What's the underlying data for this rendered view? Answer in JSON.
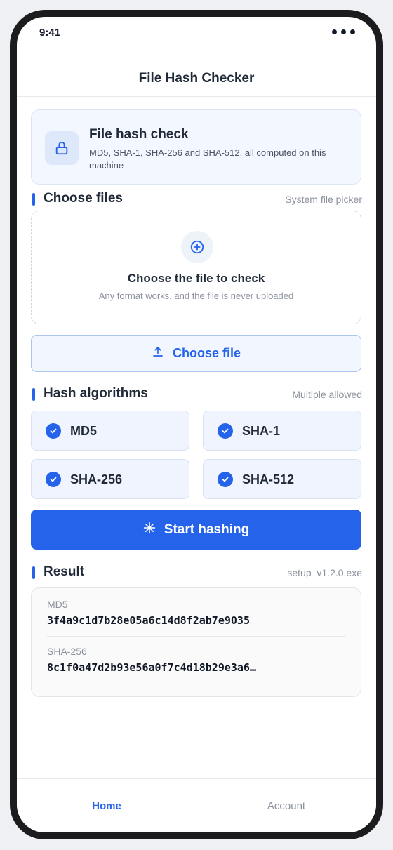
{
  "status": {
    "time": "9:41"
  },
  "header": {
    "title": "File Hash Checker"
  },
  "intro": {
    "title": "File hash check",
    "description": "MD5, SHA-1, SHA-256 and SHA-512, all computed on this machine",
    "icon": "lock-icon"
  },
  "files_section": {
    "title": "Choose files",
    "hint": "System file picker"
  },
  "dropzone": {
    "title": "Choose the file to check",
    "subtitle": "Any format works, and the file is never uploaded",
    "icon": "plus-circle-icon"
  },
  "choose_button": {
    "label": "Choose file",
    "icon": "upload-icon"
  },
  "algorithms_section": {
    "title": "Hash algorithms",
    "hint": "Multiple allowed"
  },
  "algorithms": [
    {
      "label": "MD5",
      "checked": true
    },
    {
      "label": "SHA-1",
      "checked": true
    },
    {
      "label": "SHA-256",
      "checked": true
    },
    {
      "label": "SHA-512",
      "checked": true
    }
  ],
  "start_button": {
    "label": "Start hashing",
    "icon": "sparkle-icon"
  },
  "result_section": {
    "title": "Result",
    "hint": "setup_v1.2.0.exe"
  },
  "results": [
    {
      "algorithm": "MD5",
      "hash": "3f4a9c1d7b28e05a6c14d8f2ab7e9035"
    },
    {
      "algorithm": "SHA-256",
      "hash": "8c1f0a47d2b93e56a0f7c4d18b29e3a6…"
    }
  ],
  "tabs": [
    {
      "label": "Home",
      "active": true
    },
    {
      "label": "Account",
      "active": false
    }
  ],
  "colors": {
    "accent": "#2563eb",
    "text": "#1f2937",
    "muted": "#8b919c"
  }
}
